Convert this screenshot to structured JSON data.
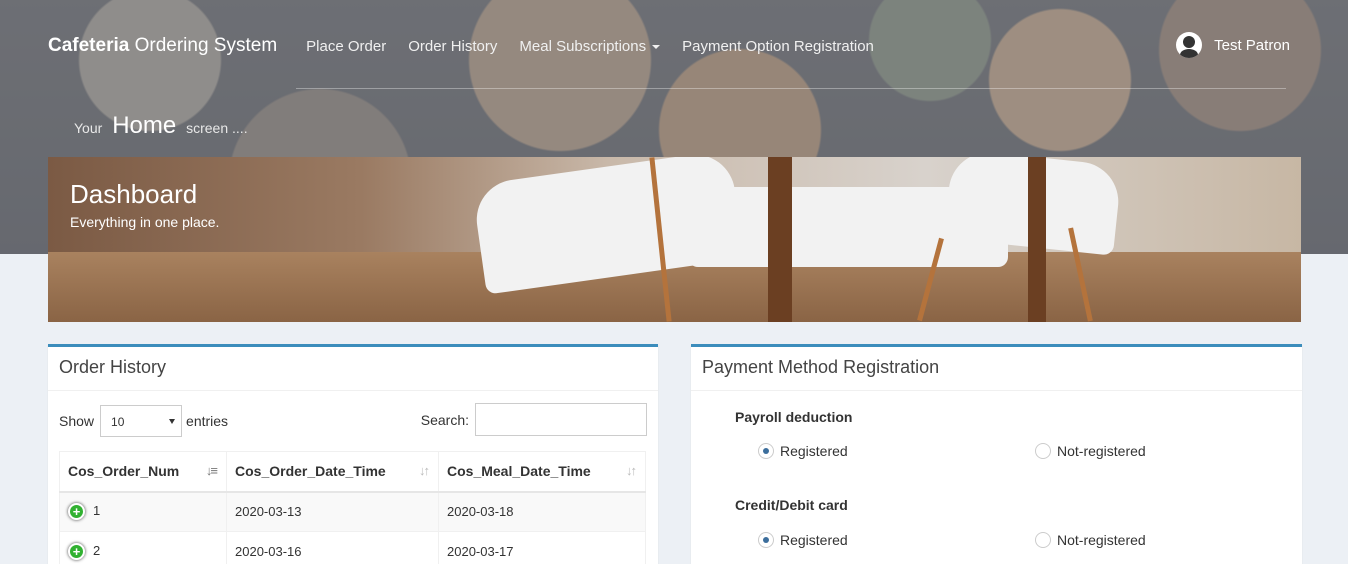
{
  "navbar": {
    "brand_bold": "Cafeteria",
    "brand_rest": "Ordering System",
    "links": [
      "Place Order",
      "Order History",
      "Meal Subscriptions",
      "Payment Option Registration"
    ],
    "user_name": "Test Patron"
  },
  "subtitle": {
    "prefix": "Your",
    "main": "Home",
    "suffix": "screen ...."
  },
  "banner": {
    "title": "Dashboard",
    "subtitle": "Everything in one place."
  },
  "order_history": {
    "title": "Order History",
    "show_label": "Show",
    "entries_value": "10",
    "entries_label": "entries",
    "search_label": "Search:",
    "columns": [
      "Cos_Order_Num",
      "Cos_Order_Date_Time",
      "Cos_Meal_Date_Time"
    ],
    "rows": [
      {
        "num": "1",
        "order_date": "2020-03-13",
        "meal_date": "2020-03-18"
      },
      {
        "num": "2",
        "order_date": "2020-03-16",
        "meal_date": "2020-03-17"
      }
    ]
  },
  "payment": {
    "title": "Payment Method Registration",
    "groups": [
      {
        "label": "Payroll deduction",
        "options": [
          "Registered",
          "Not-registered"
        ],
        "selected": "Registered"
      },
      {
        "label": "Credit/Debit card",
        "options": [
          "Registered",
          "Not-registered"
        ],
        "selected": "Registered"
      }
    ]
  },
  "colors": {
    "accent": "#3c8dbc",
    "body_bg": "#ecf0f5",
    "plus_green": "#31b131"
  }
}
